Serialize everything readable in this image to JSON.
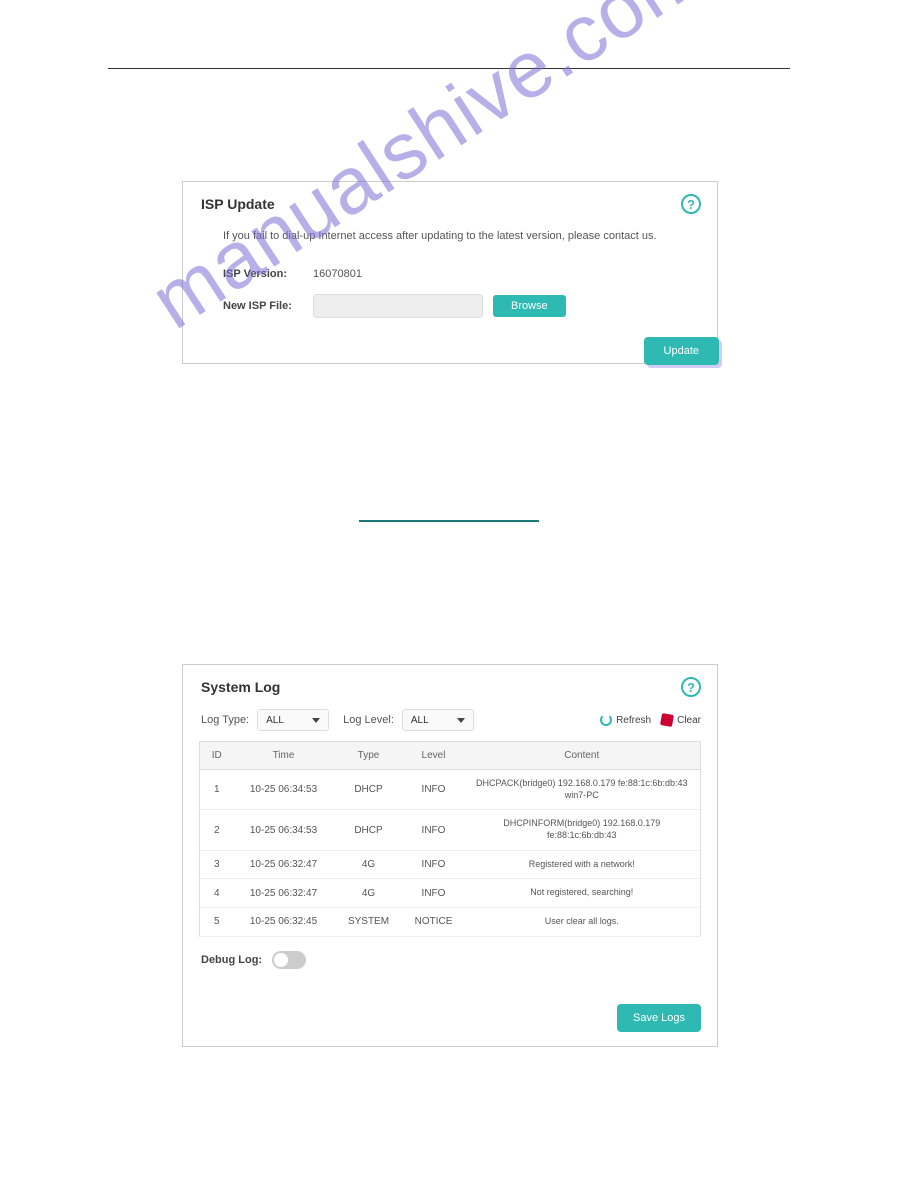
{
  "watermark": "manualshive.com",
  "isp": {
    "title": "ISP Update",
    "note": "If you fail to dial-up Internet access after updating to the latest version, please contact us.",
    "version_label": "ISP Version:",
    "version_value": "16070801",
    "newfile_label": "New ISP File:",
    "browse_label": "Browse",
    "update_label": "Update"
  },
  "log": {
    "title": "System Log",
    "type_label": "Log Type:",
    "type_value": "ALL",
    "level_label": "Log Level:",
    "level_value": "ALL",
    "refresh_label": "Refresh",
    "clear_label": "Clear",
    "columns": {
      "id": "ID",
      "time": "Time",
      "type": "Type",
      "level": "Level",
      "content": "Content"
    },
    "rows": [
      {
        "id": "1",
        "time": "10-25 06:34:53",
        "type": "DHCP",
        "level": "INFO",
        "content": "DHCPACK(bridge0) 192.168.0.179 fe:88:1c:6b:db:43 win7-PC"
      },
      {
        "id": "2",
        "time": "10-25 06:34:53",
        "type": "DHCP",
        "level": "INFO",
        "content": "DHCPINFORM(bridge0) 192.168.0.179 fe:88:1c:6b:db:43"
      },
      {
        "id": "3",
        "time": "10-25 06:32:47",
        "type": "4G",
        "level": "INFO",
        "content": "Registered with a network!"
      },
      {
        "id": "4",
        "time": "10-25 06:32:47",
        "type": "4G",
        "level": "INFO",
        "content": "Not registered, searching!"
      },
      {
        "id": "5",
        "time": "10-25 06:32:45",
        "type": "SYSTEM",
        "level": "NOTICE",
        "content": "User clear all logs."
      }
    ],
    "debug_label": "Debug Log:",
    "save_label": "Save Logs"
  }
}
